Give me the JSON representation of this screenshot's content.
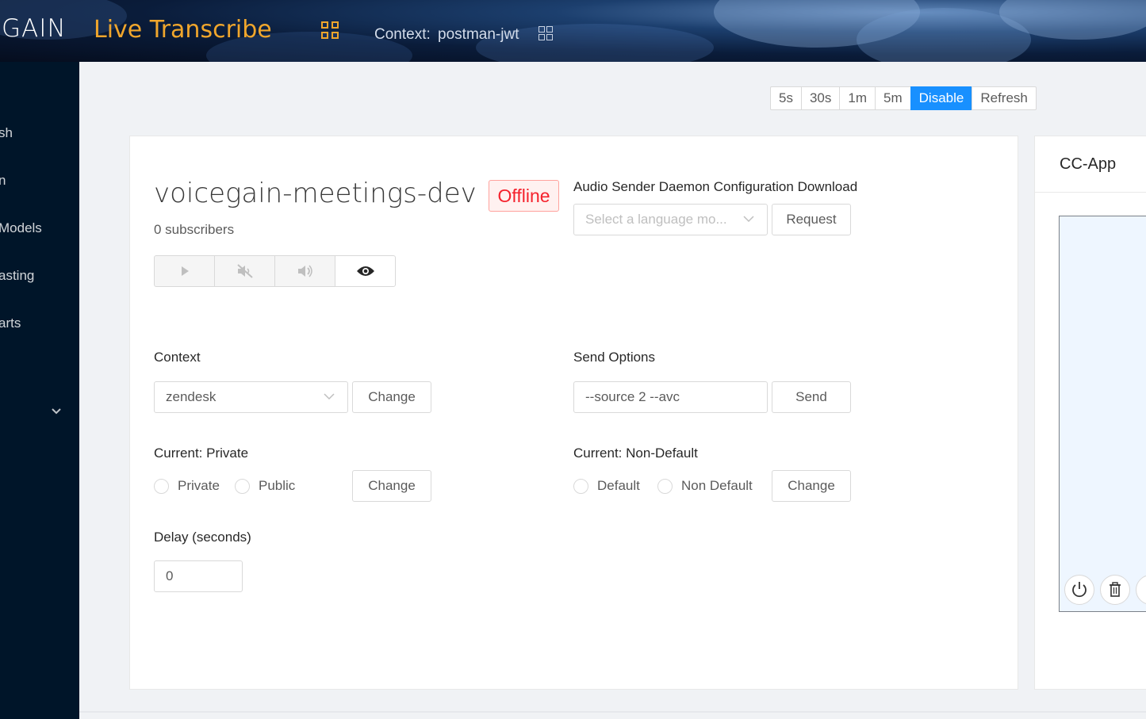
{
  "header": {
    "logo_text": "GAIN",
    "app_title": "Live Transcribe",
    "context_label": "Context:",
    "context_value": "postman-jwt"
  },
  "sidebar": {
    "items": [
      {
        "label": "sh"
      },
      {
        "label": "n"
      },
      {
        "label": "Models"
      },
      {
        "label": "asting"
      },
      {
        "label": "arts"
      }
    ]
  },
  "refresh": {
    "options": [
      "5s",
      "30s",
      "1m",
      "5m",
      "Disable"
    ],
    "active": "Disable",
    "refresh_label": "Refresh"
  },
  "stream": {
    "name": "voicegain-meetings-dev",
    "status": "Offline",
    "subscribers": "0 subscribers"
  },
  "audio_sender": {
    "title": "Audio Sender Daemon Configuration Download",
    "placeholder": "Select a language mo...",
    "request_label": "Request"
  },
  "context": {
    "label": "Context",
    "value": "zendesk",
    "change_label": "Change"
  },
  "send_options": {
    "label": "Send Options",
    "value": "--source 2 --avc",
    "send_label": "Send"
  },
  "privacy": {
    "label": "Current: Private",
    "options": [
      "Private",
      "Public"
    ],
    "change_label": "Change"
  },
  "default_setting": {
    "label": "Current: Non-Default",
    "options": [
      "Default",
      "Non Default"
    ],
    "change_label": "Change"
  },
  "delay": {
    "label": "Delay (seconds)",
    "value": "0"
  },
  "cc_app": {
    "title": "CC-App"
  },
  "colors": {
    "accent": "#1890ff",
    "offline": "#f5222d",
    "title_orange": "#f0a62c",
    "sidebar_bg": "#001529"
  }
}
